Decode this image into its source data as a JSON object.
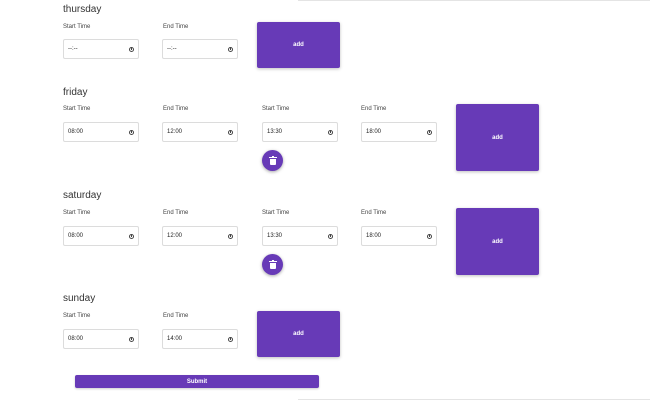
{
  "labels": {
    "start": "Start Time",
    "end": "End Time"
  },
  "days": [
    {
      "name": "thursday",
      "fields": [
        "--:--",
        "--:--"
      ],
      "add": "add"
    },
    {
      "name": "friday",
      "fields": [
        "08:00",
        "12:00",
        "13:30",
        "18:00"
      ],
      "add": "add"
    },
    {
      "name": "saturday",
      "fields": [
        "08:00",
        "12:00",
        "13:30",
        "18:00"
      ],
      "add": "add"
    },
    {
      "name": "sunday",
      "fields": [
        "08:00",
        "14:00"
      ],
      "add": "add"
    }
  ],
  "submit_label": "Submit",
  "icons": {
    "clock": "clock-icon",
    "delete": "trash-icon"
  },
  "colors": {
    "accent": "#673ab7"
  }
}
